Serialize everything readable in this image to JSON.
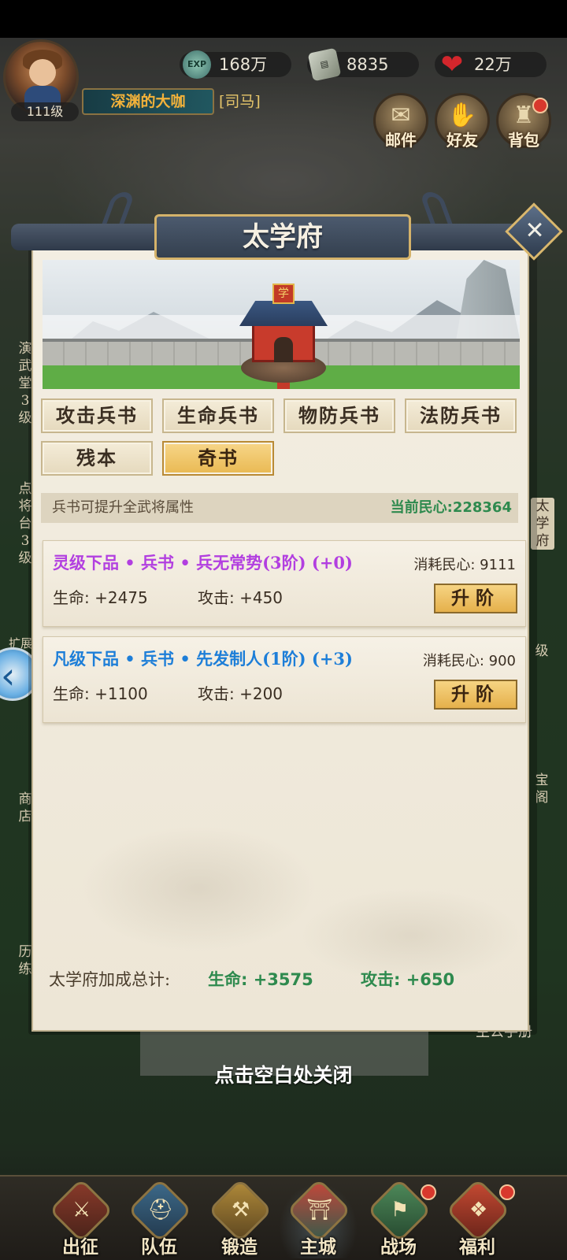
{
  "hud": {
    "level": "111级",
    "player_name": "深渊的大咖",
    "player_title": "[司马]",
    "exp_icon_text": "EXP",
    "exp": "168万",
    "books": "8835",
    "hearts": "22万",
    "buttons": [
      {
        "label": "邮件",
        "icon": "mail-scroll-icon",
        "badge": false
      },
      {
        "label": "好友",
        "icon": "handshake-icon",
        "badge": false
      },
      {
        "label": "背包",
        "icon": "bag-icon",
        "badge": true
      }
    ]
  },
  "side": {
    "left_1": [
      "演",
      "武",
      "堂",
      "3",
      "级"
    ],
    "left_2": [
      "点",
      "将",
      "台",
      "3",
      "级"
    ],
    "left_3": "扩展",
    "left_4": [
      "商",
      "店"
    ],
    "left_5": [
      "历",
      "练"
    ],
    "right_1": [
      "太",
      "学",
      "府"
    ],
    "right_2": "级",
    "right_3": [
      "宝",
      "阁"
    ],
    "right_4": "主公手册"
  },
  "panel": {
    "title": "太学府",
    "building_sign": "学",
    "tabs": [
      {
        "label": "攻击兵书",
        "active": false
      },
      {
        "label": "生命兵书",
        "active": false
      },
      {
        "label": "物防兵书",
        "active": false
      },
      {
        "label": "法防兵书",
        "active": false
      },
      {
        "label": "残本",
        "active": false
      },
      {
        "label": "奇书",
        "active": true
      }
    ],
    "info_left": "兵书可提升全武将属性",
    "info_right": "当前民心:228364",
    "books": [
      {
        "name": "灵级下品 • 兵书 • 兵无常势(3阶) (+0)",
        "color": "#b23fe0",
        "cost": "消耗民心: 9111",
        "hp": "生命: +2475",
        "atk": "攻击: +450",
        "button": "升阶"
      },
      {
        "name": "凡级下品 • 兵书 • 先发制人(1阶) (+3)",
        "color": "#1d7ed8",
        "cost": "消耗民心: 900",
        "hp": "生命: +1100",
        "atk": "攻击: +200",
        "button": "升阶"
      }
    ],
    "total_label": "太学府加成总计:",
    "total_hp": "生命: +3575",
    "total_atk": "攻击: +650"
  },
  "close_hint": "点击空白处关闭",
  "nav": [
    {
      "label": "出征",
      "icon": "crossed-swords-icon",
      "badge": false,
      "active": false
    },
    {
      "label": "队伍",
      "icon": "helmet-icon",
      "badge": false,
      "active": false
    },
    {
      "label": "锻造",
      "icon": "anvil-icon",
      "badge": false,
      "active": false
    },
    {
      "label": "主城",
      "icon": "palace-icon",
      "badge": false,
      "active": true
    },
    {
      "label": "战场",
      "icon": "battle-flag-icon",
      "badge": true,
      "active": false
    },
    {
      "label": "福利",
      "icon": "gift-pavilion-icon",
      "badge": true,
      "active": false
    }
  ]
}
